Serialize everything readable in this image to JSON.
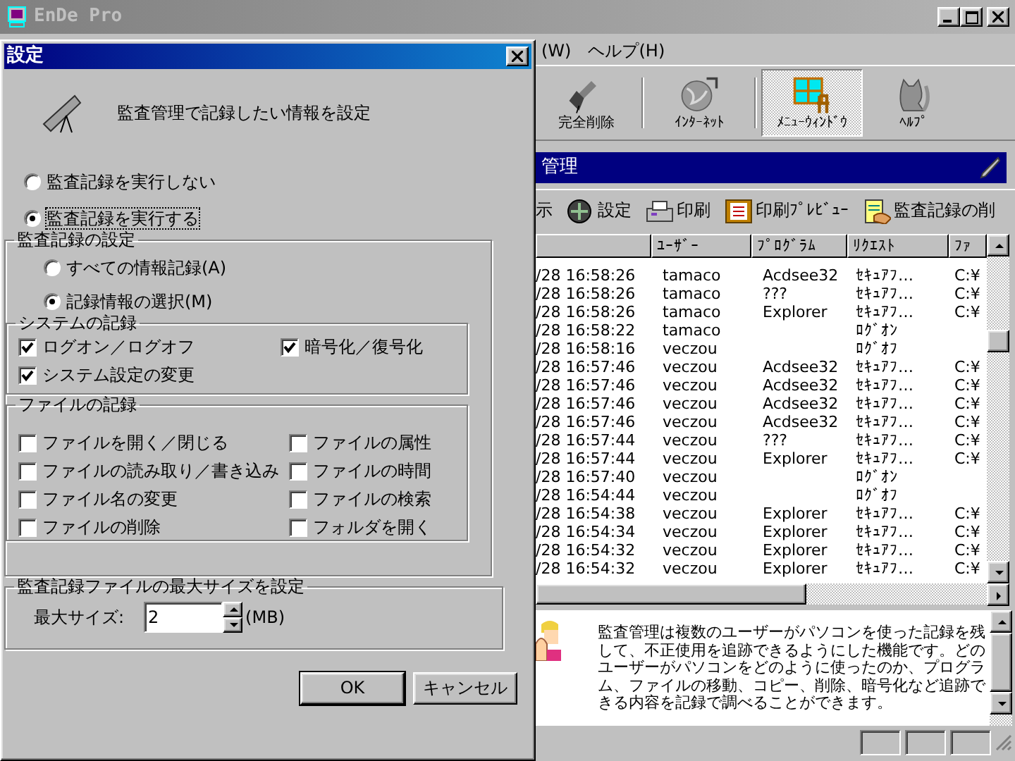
{
  "main_window": {
    "title": "EnDe Pro",
    "menu": [
      {
        "label": "(W)"
      },
      {
        "label": "ヘルプ(H)"
      }
    ],
    "toolbar": [
      {
        "label": "完全削除",
        "selected": false
      },
      {
        "label": "ｲﾝﾀｰﾈｯﾄ",
        "selected": false
      },
      {
        "label": "ﾒﾆｭｰｳｨﾝﾄﾞｳ",
        "selected": true
      },
      {
        "label": "ﾍﾙﾌﾟ",
        "selected": false
      }
    ],
    "panel_title": "管理",
    "actions": [
      {
        "label": "示"
      },
      {
        "label": "設定"
      },
      {
        "label": "印刷"
      },
      {
        "label": "印刷ﾌﾟﾚﾋﾞｭｰ"
      },
      {
        "label": "監査記録の削"
      }
    ],
    "table": {
      "columns": [
        {
          "label": "ﾕｰｻﾞｰ"
        },
        {
          "label": "ﾌﾟﾛｸﾞﾗﾑ"
        },
        {
          "label": "ﾘｸｴｽﾄ"
        },
        {
          "label": "ﾌｧ"
        }
      ],
      "rows": [
        {
          "time": "/28 16:58:26",
          "user": "tamaco",
          "program": "Acdsee32",
          "request": "ｾｷｭｱﾌ…",
          "column_5": "C:¥"
        },
        {
          "time": "/28 16:58:26",
          "user": "tamaco",
          "program": "???",
          "request": "ｾｷｭｱﾌ…",
          "column_5": "C:¥"
        },
        {
          "time": "/28 16:58:26",
          "user": "tamaco",
          "program": "Explorer",
          "request": "ｾｷｭｱﾌ…",
          "column_5": "C:¥"
        },
        {
          "time": "/28 16:58:22",
          "user": "tamaco",
          "request": "ﾛｸﾞｵﾝ"
        },
        {
          "time": "/28 16:58:16",
          "user": "veczou",
          "request": "ﾛｸﾞｵﾌ"
        },
        {
          "time": "/28 16:57:46",
          "user": "veczou",
          "program": "Acdsee32",
          "request": "ｾｷｭｱﾌ…",
          "column_5": "C:¥"
        },
        {
          "time": "/28 16:57:46",
          "user": "veczou",
          "program": "Acdsee32",
          "request": "ｾｷｭｱﾌ…",
          "column_5": "C:¥"
        },
        {
          "time": "/28 16:57:46",
          "user": "veczou",
          "program": "Acdsee32",
          "request": "ｾｷｭｱﾌ…",
          "column_5": "C:¥"
        },
        {
          "time": "/28 16:57:46",
          "user": "veczou",
          "program": "Acdsee32",
          "request": "ｾｷｭｱﾌ…",
          "column_5": "C:¥"
        },
        {
          "time": "/28 16:57:44",
          "user": "veczou",
          "program": "???",
          "request": "ｾｷｭｱﾌ…",
          "column_5": "C:¥"
        },
        {
          "time": "/28 16:57:44",
          "user": "veczou",
          "program": "Explorer",
          "request": "ｾｷｭｱﾌ…",
          "column_5": "C:¥"
        },
        {
          "time": "/28 16:57:40",
          "user": "veczou",
          "request": "ﾛｸﾞｵﾝ"
        },
        {
          "time": "/28 16:54:44",
          "user": "veczou",
          "request": "ﾛｸﾞｵﾌ"
        },
        {
          "time": "/28 16:54:38",
          "user": "veczou",
          "program": "Explorer",
          "request": "ｾｷｭｱﾌ…",
          "column_5": "C:¥"
        },
        {
          "time": "/28 16:54:34",
          "user": "veczou",
          "program": "Explorer",
          "request": "ｾｷｭｱﾌ…",
          "column_5": "C:¥"
        },
        {
          "time": "/28 16:54:32",
          "user": "veczou",
          "program": "Explorer",
          "request": "ｾｷｭｱﾌ…",
          "column_5": "C:¥"
        },
        {
          "time": "/28 16:54:32",
          "user": "veczou",
          "program": "Explorer",
          "request": "ｾｷｭｱﾌ…",
          "column_5": "C:¥"
        }
      ]
    },
    "description": "監査管理は複数のユーザーがパソコンを使った記録を残して、不正使用を追跡できるようにした機能です。どのユーザーがパソコンをどのように使ったのか、プログラム、ファイルの移動、コピー、削除、暗号化など追跡できる内容を記録で調べることができます。"
  },
  "dialog": {
    "title": "設定",
    "heading": "監査管理で記録したい情報を設定",
    "mode_options": [
      {
        "label": "監査記録を実行しない",
        "selected": false,
        "focused": false
      },
      {
        "label": "監査記録を実行する",
        "selected": true,
        "focused": true
      }
    ],
    "settings_group": {
      "title": "監査記録の設定",
      "scope_options": [
        {
          "label": "すべての情報記録(A)",
          "selected": false
        },
        {
          "label": "記録情報の選択(M)",
          "selected": true
        }
      ],
      "system_group": {
        "title": "システムの記録",
        "items": [
          {
            "label": "ログオン／ログオフ",
            "checked": true
          },
          {
            "label": "暗号化／復号化",
            "checked": true
          },
          {
            "label": "システム設定の変更",
            "checked": true
          }
        ]
      },
      "file_group": {
        "title": "ファイルの記録",
        "items": [
          {
            "label": "ファイルを開く／閉じる",
            "checked": false
          },
          {
            "label": "ファイルの属性",
            "checked": false
          },
          {
            "label": "ファイルの読み取り／書き込み",
            "checked": false
          },
          {
            "label": "ファイルの時間",
            "checked": false
          },
          {
            "label": "ファイル名の変更",
            "checked": false
          },
          {
            "label": "ファイルの検索",
            "checked": false
          },
          {
            "label": "ファイルの削除",
            "checked": false
          },
          {
            "label": "フォルダを開く",
            "checked": false
          }
        ]
      }
    },
    "size_group": {
      "title": "監査記録ファイルの最大サイズを設定",
      "label": "最大サイズ:",
      "value": "2",
      "unit": "(MB)"
    },
    "buttons": [
      {
        "label": "OK",
        "default": true
      },
      {
        "label": "キャンセル",
        "default": false
      }
    ]
  }
}
